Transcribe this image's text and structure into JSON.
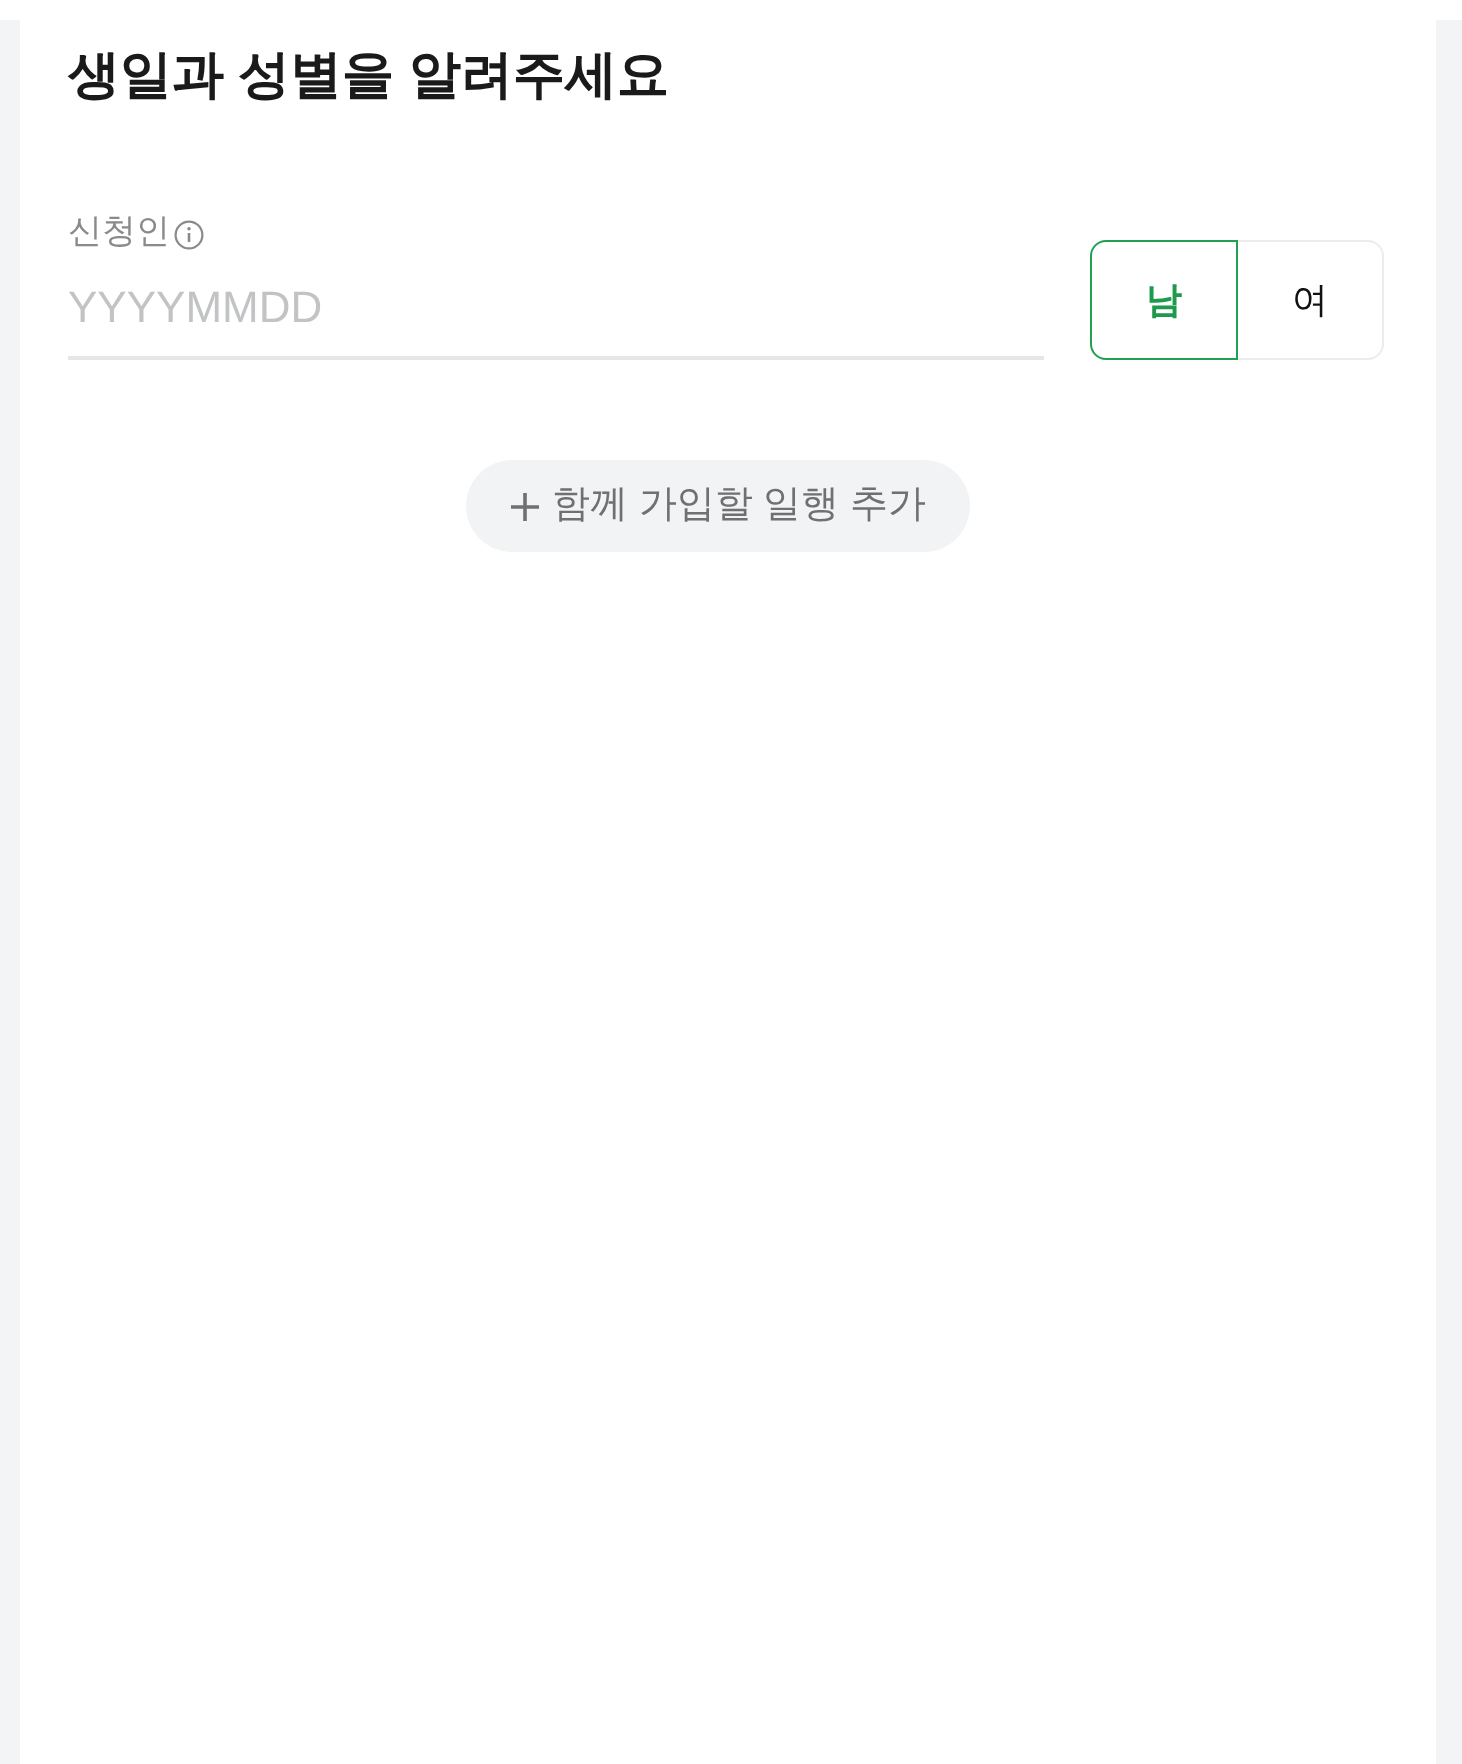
{
  "heading": "생일과 성별을 알려주세요",
  "applicant": {
    "label": "신청인",
    "birthdate": {
      "placeholder": "YYYYMMDD"
    },
    "gender_options": [
      {
        "label": "남",
        "selected": true
      },
      {
        "label": "여",
        "selected": false
      }
    ]
  },
  "add_companion_button": {
    "label": "함께 가입할 일행 추가"
  }
}
